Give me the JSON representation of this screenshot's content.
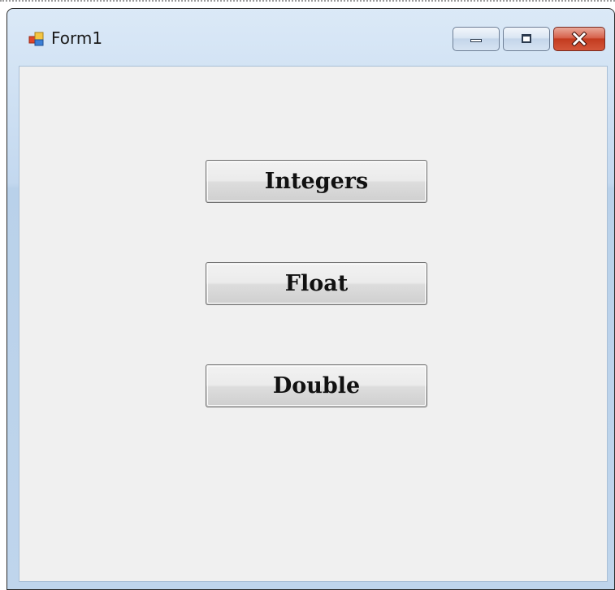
{
  "window": {
    "title": "Form1",
    "icon": "winforms-app-icon",
    "caption_buttons": [
      "minimize-icon",
      "maximize-icon",
      "close-icon"
    ]
  },
  "form": {
    "buttons": [
      {
        "label": "Integers"
      },
      {
        "label": "Float"
      },
      {
        "label": "Double"
      }
    ]
  }
}
